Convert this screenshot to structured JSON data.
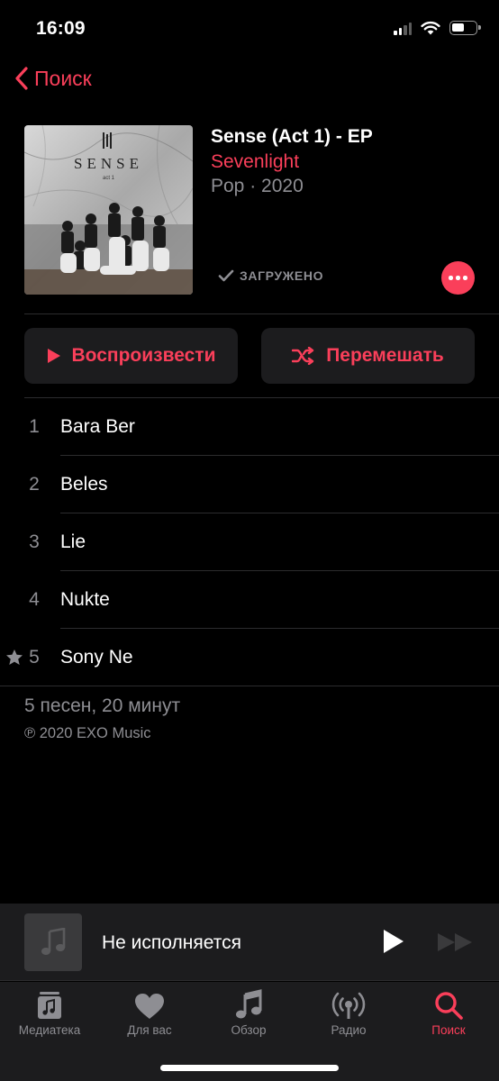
{
  "status_bar": {
    "time": "16:09",
    "battery_level": 0.55
  },
  "nav": {
    "back_label": "Поиск"
  },
  "album": {
    "title": "Sense (Act 1) - EP",
    "artist": "Sevenlight",
    "meta": "Pop · 2020",
    "download_status": "ЗАГРУЖЕНО",
    "cover_text": "SENSE",
    "cover_subtext": "act 1"
  },
  "actions": {
    "play_label": "Воспроизвести",
    "shuffle_label": "Перемешать"
  },
  "tracks": [
    {
      "number": "1",
      "title": "Bara Ber",
      "starred": false
    },
    {
      "number": "2",
      "title": "Beles",
      "starred": false
    },
    {
      "number": "3",
      "title": "Lie",
      "starred": false
    },
    {
      "number": "4",
      "title": "Nukte",
      "starred": false
    },
    {
      "number": "5",
      "title": "Sony Ne",
      "starred": true
    }
  ],
  "footer": {
    "summary": "5 песен, 20 минут",
    "copyright": "℗ 2020 EXO Music"
  },
  "mini_player": {
    "title": "Не исполняется"
  },
  "tabs": [
    {
      "label": "Медиатека",
      "icon": "library-icon",
      "active": false
    },
    {
      "label": "Для вас",
      "icon": "heart-icon",
      "active": false
    },
    {
      "label": "Обзор",
      "icon": "music-note-icon",
      "active": false
    },
    {
      "label": "Радио",
      "icon": "radio-icon",
      "active": false
    },
    {
      "label": "Поиск",
      "icon": "search-icon",
      "active": true
    }
  ],
  "colors": {
    "accent": "#fa3f5a",
    "secondary_text": "#8e8e93",
    "background": "#000000",
    "surface": "#1c1c1e"
  }
}
